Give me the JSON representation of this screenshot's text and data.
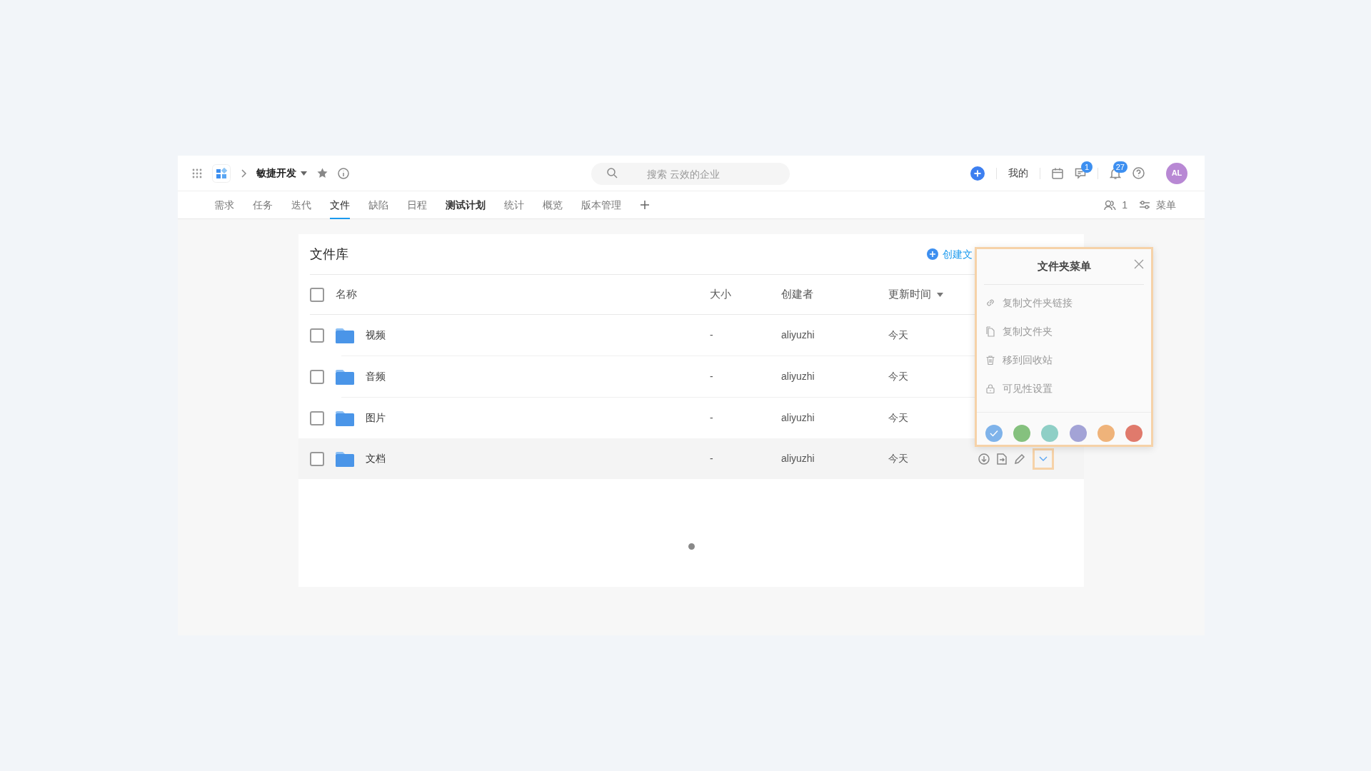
{
  "topbar": {
    "project": "敏捷开发",
    "search": {
      "placeholder": "搜索 云效的企业"
    },
    "mine": "我的",
    "message_badge": "1",
    "notification_badge": "27",
    "avatar": "AL"
  },
  "tabs": [
    {
      "label": "需求",
      "selected": false,
      "bold": false
    },
    {
      "label": "任务",
      "selected": false,
      "bold": false
    },
    {
      "label": "迭代",
      "selected": false,
      "bold": false
    },
    {
      "label": "文件",
      "selected": true,
      "bold": false
    },
    {
      "label": "缺陷",
      "selected": false,
      "bold": false
    },
    {
      "label": "日程",
      "selected": false,
      "bold": false
    },
    {
      "label": "测试计划",
      "selected": false,
      "bold": true
    },
    {
      "label": "统计",
      "selected": false,
      "bold": false
    },
    {
      "label": "概览",
      "selected": false,
      "bold": false
    },
    {
      "label": "版本管理",
      "selected": false,
      "bold": false
    }
  ],
  "toolbar": {
    "members": "1",
    "menu": "菜单"
  },
  "library": {
    "title": "文件库",
    "create": "创建文",
    "all_checked": false,
    "columns": [
      {
        "label": "名称",
        "sorted": false
      },
      {
        "label": "大小",
        "sorted": false
      },
      {
        "label": "创建者",
        "sorted": false
      },
      {
        "label": "更新时间",
        "sorted": true
      }
    ],
    "rows": [
      {
        "name": "视频",
        "size": "-",
        "creator": "aliyuzhi",
        "updated": "今天",
        "checked": false,
        "hovered": false,
        "menu_open": false
      },
      {
        "name": "音频",
        "size": "-",
        "creator": "aliyuzhi",
        "updated": "今天",
        "checked": false,
        "hovered": false,
        "menu_open": false
      },
      {
        "name": "图片",
        "size": "-",
        "creator": "aliyuzhi",
        "updated": "今天",
        "checked": false,
        "hovered": false,
        "menu_open": false
      },
      {
        "name": "文档",
        "size": "-",
        "creator": "aliyuzhi",
        "updated": "今天",
        "checked": false,
        "hovered": true,
        "menu_open": true
      }
    ]
  },
  "folder_menu": {
    "title": "文件夹菜单",
    "items": [
      {
        "label": "复制文件夹链接",
        "kind": "link"
      },
      {
        "label": "复制文件夹",
        "kind": "copy"
      },
      {
        "label": "移到回收站",
        "kind": "trash"
      },
      {
        "label": "可见性设置",
        "kind": "lock"
      }
    ],
    "colors": [
      {
        "color": "#7fb3ea",
        "selected": true
      },
      {
        "color": "#85c17e",
        "selected": false
      },
      {
        "color": "#8fcfc6",
        "selected": false
      },
      {
        "color": "#a3a3d6",
        "selected": false
      },
      {
        "color": "#efb37a",
        "selected": false
      },
      {
        "color": "#e07a6c",
        "selected": false
      }
    ]
  }
}
